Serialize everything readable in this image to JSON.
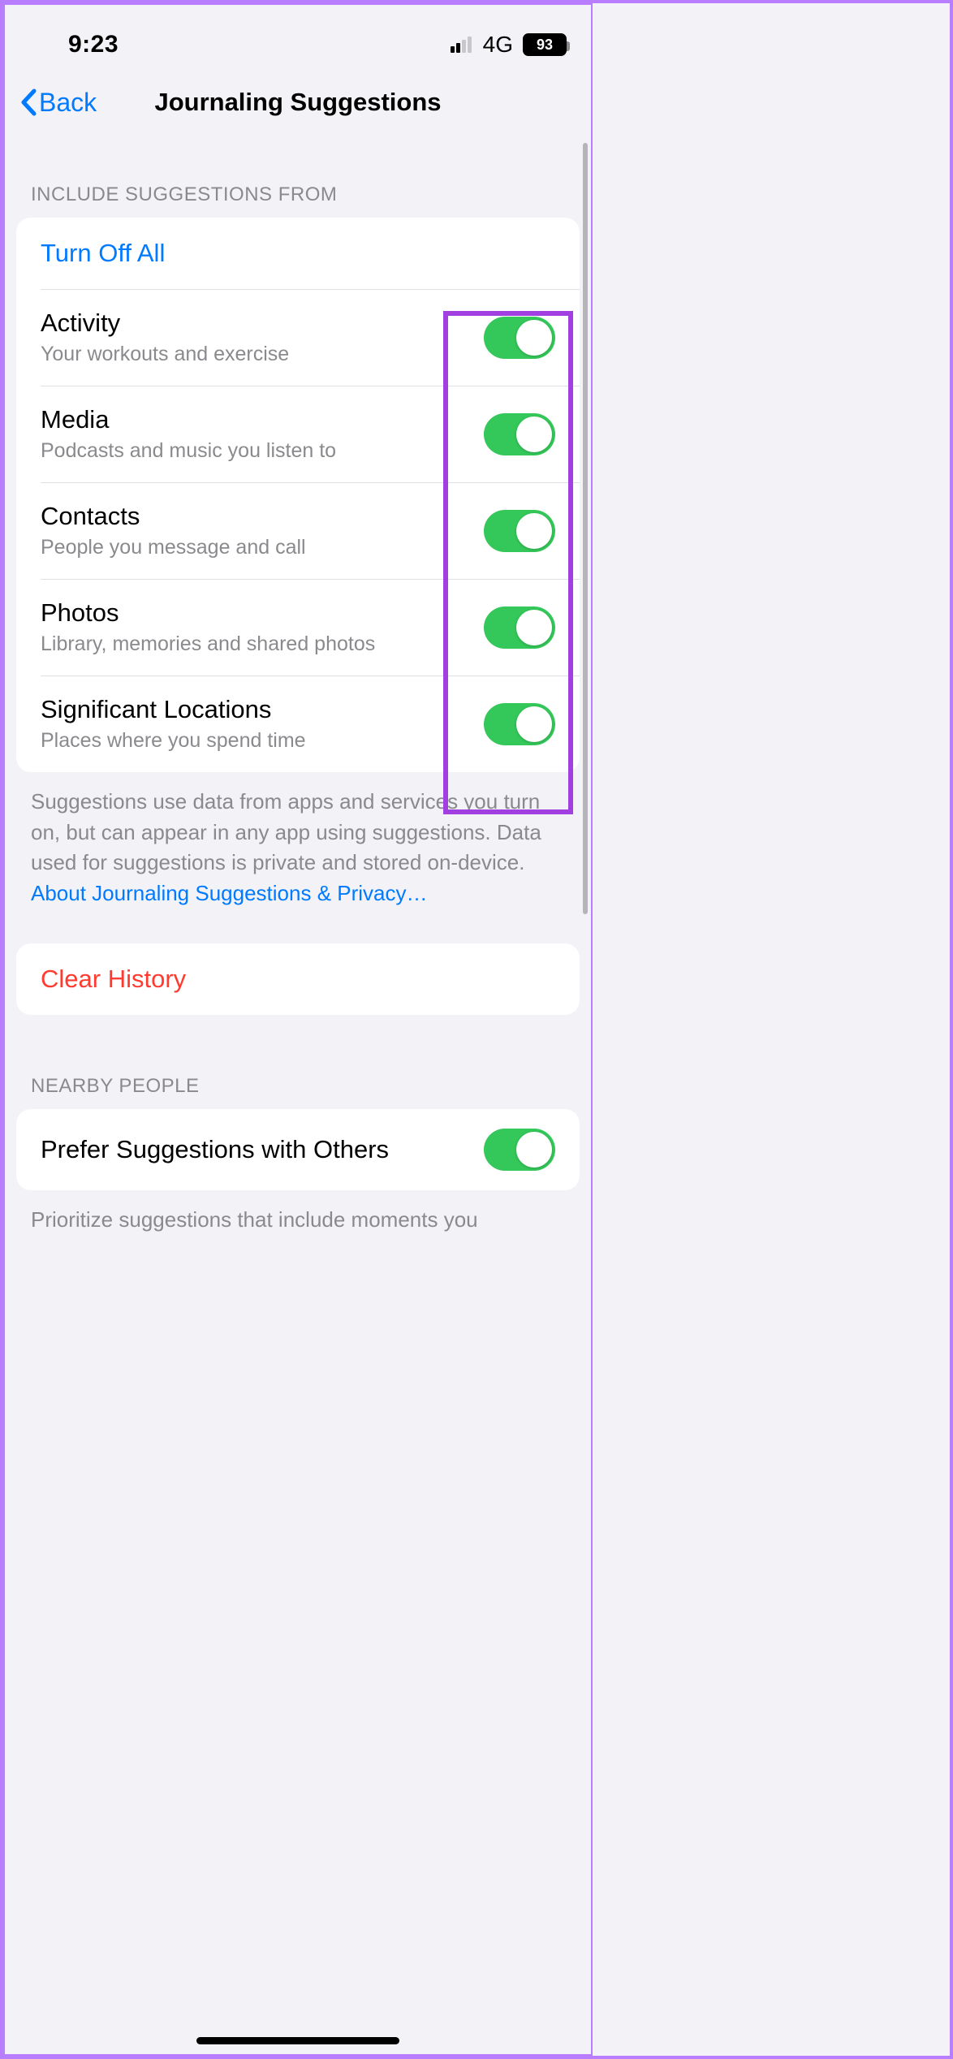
{
  "status": {
    "time": "9:23",
    "network": "4G",
    "battery_pct": "93"
  },
  "nav": {
    "back_label": "Back",
    "title": "Journaling Suggestions"
  },
  "section1": {
    "header": "INCLUDE SUGGESTIONS FROM",
    "turn_off_all": "Turn Off All",
    "items": [
      {
        "title": "Activity",
        "sub": "Your workouts and exercise",
        "on": true
      },
      {
        "title": "Media",
        "sub": "Podcasts and music you listen to",
        "on": true
      },
      {
        "title": "Contacts",
        "sub": "People you message and call",
        "on": true
      },
      {
        "title": "Photos",
        "sub": "Library, memories and shared photos",
        "on": true
      },
      {
        "title": "Significant Locations",
        "sub": "Places where you spend time",
        "on": true
      }
    ],
    "footer_text": "Suggestions use data from apps and services you turn on, but can appear in any app using suggestions. Data used for suggestions is private and stored on-device. ",
    "footer_link": "About Journaling Suggestions & Privacy…"
  },
  "clear_history": "Clear History",
  "section2": {
    "header": "NEARBY PEOPLE",
    "item_title": "Prefer Suggestions with Others",
    "item_on": true,
    "footer_partial": "Prioritize suggestions that include moments you"
  }
}
